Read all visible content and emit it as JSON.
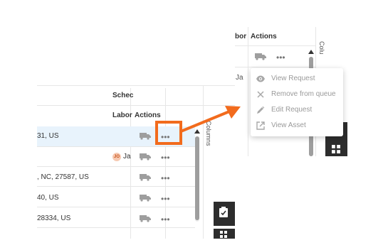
{
  "grid": {
    "columns": {
      "scheduled_partial": "Schec",
      "labor_partial": "Labor",
      "actions": "Actions"
    },
    "rows": [
      {
        "address": "31, US",
        "assignee": "",
        "selected": true
      },
      {
        "address": "",
        "assignee": "Ja",
        "assignee_initials": "JO",
        "selected": false
      },
      {
        "address": ", NC, 27587, US",
        "assignee": "",
        "selected": false
      },
      {
        "address": "40, US",
        "assignee": "",
        "selected": false
      },
      {
        "address": "28334, US",
        "assignee": "",
        "selected": false
      }
    ],
    "side_label": "Columns",
    "more_glyph": "•••"
  },
  "zoom": {
    "columns": {
      "labor_partial": "bor",
      "actions": "Actions"
    },
    "row_assignee": "Ja",
    "side_label": "Colu",
    "more_glyph": "•••"
  },
  "menu": {
    "items": [
      {
        "label": "View Request",
        "icon": "eye-icon"
      },
      {
        "label": "Remove from queue",
        "icon": "close-icon"
      },
      {
        "label": "Edit Request",
        "icon": "pencil-icon"
      },
      {
        "label": "View Asset",
        "icon": "external-link-icon"
      }
    ]
  },
  "colors": {
    "highlight": "#f26b1d",
    "selected_row": "#e8f3fc",
    "menu_text": "#9a9a9a",
    "dark_tab": "#2d2d2d"
  }
}
